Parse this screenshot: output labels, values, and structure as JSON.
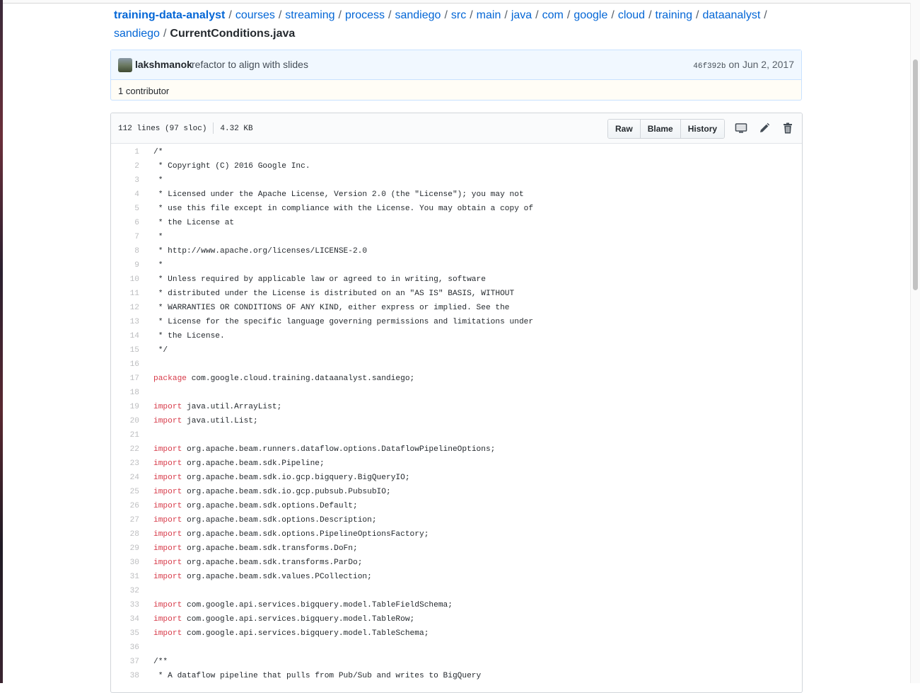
{
  "breadcrumb": {
    "repo": "training-data-analyst",
    "segments": [
      "courses",
      "streaming",
      "process",
      "sandiego",
      "src",
      "main",
      "java",
      "com",
      "google",
      "cloud",
      "training",
      "dataanalyst",
      "sandiego"
    ],
    "file": "CurrentConditions.java"
  },
  "commit": {
    "author": "lakshmanok",
    "message": "refactor to align with slides",
    "sha": "46f392b",
    "date_prefix": "on",
    "date": "Jun 2, 2017",
    "contributors": "1 contributor"
  },
  "file": {
    "lines_info": "112 lines (97 sloc)",
    "size": "4.32 KB",
    "buttons": {
      "raw": "Raw",
      "blame": "Blame",
      "history": "History"
    },
    "icons": [
      "desktop-icon",
      "pencil-icon",
      "trash-icon"
    ]
  },
  "code": [
    {
      "n": "1",
      "kw": "",
      "text": "/*"
    },
    {
      "n": "2",
      "kw": "",
      "text": " * Copyright (C) 2016 Google Inc."
    },
    {
      "n": "3",
      "kw": "",
      "text": " *"
    },
    {
      "n": "4",
      "kw": "",
      "text": " * Licensed under the Apache License, Version 2.0 (the \"License\"); you may not"
    },
    {
      "n": "5",
      "kw": "",
      "text": " * use this file except in compliance with the License. You may obtain a copy of"
    },
    {
      "n": "6",
      "kw": "",
      "text": " * the License at"
    },
    {
      "n": "7",
      "kw": "",
      "text": " *"
    },
    {
      "n": "8",
      "kw": "",
      "text": " * http://www.apache.org/licenses/LICENSE-2.0"
    },
    {
      "n": "9",
      "kw": "",
      "text": " *"
    },
    {
      "n": "10",
      "kw": "",
      "text": " * Unless required by applicable law or agreed to in writing, software"
    },
    {
      "n": "11",
      "kw": "",
      "text": " * distributed under the License is distributed on an \"AS IS\" BASIS, WITHOUT"
    },
    {
      "n": "12",
      "kw": "",
      "text": " * WARRANTIES OR CONDITIONS OF ANY KIND, either express or implied. See the"
    },
    {
      "n": "13",
      "kw": "",
      "text": " * License for the specific language governing permissions and limitations under"
    },
    {
      "n": "14",
      "kw": "",
      "text": " * the License."
    },
    {
      "n": "15",
      "kw": "",
      "text": " */"
    },
    {
      "n": "16",
      "kw": "",
      "text": ""
    },
    {
      "n": "17",
      "kw": "package",
      "text": " com.google.cloud.training.dataanalyst.sandiego;"
    },
    {
      "n": "18",
      "kw": "",
      "text": ""
    },
    {
      "n": "19",
      "kw": "import",
      "text": " java.util.ArrayList;"
    },
    {
      "n": "20",
      "kw": "import",
      "text": " java.util.List;"
    },
    {
      "n": "21",
      "kw": "",
      "text": ""
    },
    {
      "n": "22",
      "kw": "import",
      "text": " org.apache.beam.runners.dataflow.options.DataflowPipelineOptions;"
    },
    {
      "n": "23",
      "kw": "import",
      "text": " org.apache.beam.sdk.Pipeline;"
    },
    {
      "n": "24",
      "kw": "import",
      "text": " org.apache.beam.sdk.io.gcp.bigquery.BigQueryIO;"
    },
    {
      "n": "25",
      "kw": "import",
      "text": " org.apache.beam.sdk.io.gcp.pubsub.PubsubIO;"
    },
    {
      "n": "26",
      "kw": "import",
      "text": " org.apache.beam.sdk.options.Default;"
    },
    {
      "n": "27",
      "kw": "import",
      "text": " org.apache.beam.sdk.options.Description;"
    },
    {
      "n": "28",
      "kw": "import",
      "text": " org.apache.beam.sdk.options.PipelineOptionsFactory;"
    },
    {
      "n": "29",
      "kw": "import",
      "text": " org.apache.beam.sdk.transforms.DoFn;"
    },
    {
      "n": "30",
      "kw": "import",
      "text": " org.apache.beam.sdk.transforms.ParDo;"
    },
    {
      "n": "31",
      "kw": "import",
      "text": " org.apache.beam.sdk.values.PCollection;"
    },
    {
      "n": "32",
      "kw": "",
      "text": ""
    },
    {
      "n": "33",
      "kw": "import",
      "text": " com.google.api.services.bigquery.model.TableFieldSchema;"
    },
    {
      "n": "34",
      "kw": "import",
      "text": " com.google.api.services.bigquery.model.TableRow;"
    },
    {
      "n": "35",
      "kw": "import",
      "text": " com.google.api.services.bigquery.model.TableSchema;"
    },
    {
      "n": "36",
      "kw": "",
      "text": ""
    },
    {
      "n": "37",
      "kw": "",
      "text": "/**"
    },
    {
      "n": "38",
      "kw": "",
      "text": " * A dataflow pipeline that pulls from Pub/Sub and writes to BigQuery"
    }
  ],
  "colors": {
    "link": "#0366d6",
    "keyword": "#d73a49",
    "commit_bg": "#f1f8ff",
    "commit_border": "#c8e1ff"
  }
}
